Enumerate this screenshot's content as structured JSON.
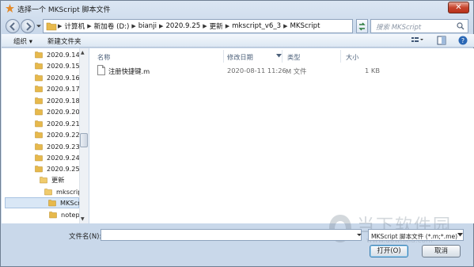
{
  "window": {
    "title": "选择一个 MKScript 脚本文件",
    "close_label": "✕"
  },
  "address": {
    "crumbs": [
      "计算机",
      "新加卷 (D:)",
      "bianji",
      "2020.9.25",
      "更新",
      "mkscript_v6_3",
      "MKScript"
    ]
  },
  "search": {
    "placeholder": "搜索 MKScript"
  },
  "toolbar": {
    "organize": "组织 ▾",
    "new_folder": "新建文件夹"
  },
  "tree": {
    "items": [
      {
        "label": "2020.9.14"
      },
      {
        "label": "2020.9.15"
      },
      {
        "label": "2020.9.16"
      },
      {
        "label": "2020.9.17"
      },
      {
        "label": "2020.9.18"
      },
      {
        "label": "2020.9.20"
      },
      {
        "label": "2020.9.21"
      },
      {
        "label": "2020.9.22"
      },
      {
        "label": "2020.9.23"
      },
      {
        "label": "2020.9.24"
      },
      {
        "label": "2020.9.25"
      },
      {
        "label": "更新"
      },
      {
        "label": "mkscript"
      },
      {
        "label": "MKScri"
      },
      {
        "label": "notepa"
      }
    ]
  },
  "columns": {
    "name": "名称",
    "date": "修改日期",
    "type": "类型",
    "size": "大小"
  },
  "files": [
    {
      "name": "注册快捷键.m",
      "date": "2020-08-11 11:26",
      "type": "M 文件",
      "size": "1 KB"
    }
  ],
  "footer": {
    "filename_label": "文件名(N):",
    "filename_value": "",
    "filetype": "MKScript 脚本文件 (*.m;*.me)",
    "open_label": "打开(O)",
    "cancel_label": "取消"
  },
  "watermark": {
    "text_cn": "当下软件园",
    "text_en": "www.downxia.com"
  },
  "colors": {
    "accent": "#3c7fb1",
    "close": "#c7452d",
    "folder": "#e7b94c"
  }
}
